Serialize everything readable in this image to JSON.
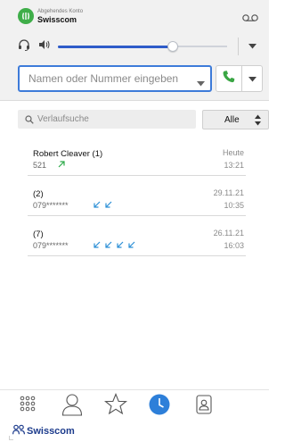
{
  "account": {
    "label": "Abgehendes Konto",
    "name": "Swisscom"
  },
  "audio": {
    "volume_percent": 68
  },
  "dial": {
    "placeholder": "Namen oder Nummer eingeben"
  },
  "search": {
    "placeholder": "Verlaufsuche"
  },
  "filter": {
    "value": "Alle"
  },
  "history": [
    {
      "name": "Robert Cleaver (1)",
      "number": "521",
      "date": "Heute",
      "time": "13:21",
      "call_icons": [
        "outgoing-call-icon"
      ]
    },
    {
      "name": "(2)",
      "number": "079*******",
      "date": "29.11.21",
      "time": "10:35",
      "call_icons": [
        "incoming-call-icon",
        "incoming-call-icon"
      ]
    },
    {
      "name": "(7)",
      "number": "079*******",
      "date": "26.11.21",
      "time": "16:03",
      "call_icons": [
        "incoming-call-icon",
        "incoming-call-icon",
        "incoming-call-icon",
        "incoming-call-icon"
      ]
    }
  ],
  "nav": {
    "active": "history",
    "items": [
      "dialpad",
      "contacts",
      "favorites",
      "history",
      "phonebook"
    ]
  },
  "footer": {
    "brand": "Swisscom"
  },
  "colors": {
    "accent": "#2e5cc9",
    "call_green": "#3aa644",
    "outgoing_arrow": "#2eaa4a",
    "incoming_arrow": "#2b8fd6",
    "brand_blue": "#1c3b8c"
  }
}
